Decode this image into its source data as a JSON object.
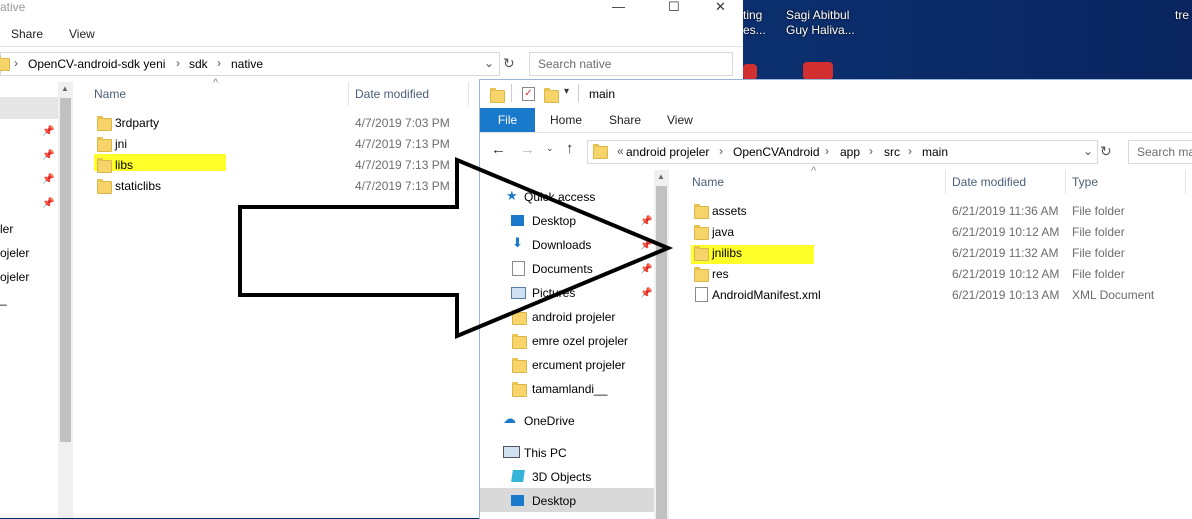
{
  "desktop": {
    "icon1_label_line1": "ting",
    "icon1_label_line2": "es...",
    "icon2_label_line1": "Sagi Abitbul",
    "icon2_label_line2": "Guy Haliva...",
    "icon3_label": "tre"
  },
  "win1": {
    "title": "ative",
    "menu": [
      "Share",
      "View"
    ],
    "breadcrumb": [
      "OpenCV-android-sdk yeni",
      "sdk",
      "native"
    ],
    "search_placeholder": "Search native",
    "nav_items": [
      "ler",
      "ojeler",
      "ojeler",
      "_"
    ],
    "columns": {
      "name": "Name",
      "date": "Date modified"
    },
    "rows": [
      {
        "name": "3rdparty",
        "date": "4/7/2019 7:03 PM"
      },
      {
        "name": "jni",
        "date": "4/7/2019 7:13 PM"
      },
      {
        "name": "libs",
        "date": "4/7/2019 7:13 PM"
      },
      {
        "name": "staticlibs",
        "date": "4/7/2019 7:13 PM"
      }
    ]
  },
  "win2": {
    "title": "main",
    "ribbon": {
      "file": "File",
      "home": "Home",
      "share": "Share",
      "view": "View"
    },
    "breadcrumb": [
      "«",
      "android projeler",
      "OpenCVAndroid",
      "app",
      "src",
      "main"
    ],
    "search_placeholder": "Search ma",
    "nav": {
      "quick_access": "Quick access",
      "desktop": "Desktop",
      "downloads": "Downloads",
      "documents": "Documents",
      "pictures": "Pictures",
      "android": "android projeler",
      "emre": "emre ozel projeler",
      "ercument": "ercument projeler",
      "tamam": "tamamlandi__",
      "onedrive": "OneDrive",
      "thispc": "This PC",
      "objects3d": "3D Objects",
      "desktop2": "Desktop"
    },
    "columns": {
      "name": "Name",
      "date": "Date modified",
      "type": "Type"
    },
    "rows": [
      {
        "name": "assets",
        "date": "6/21/2019 11:36 AM",
        "type": "File folder"
      },
      {
        "name": "java",
        "date": "6/21/2019 10:12 AM",
        "type": "File folder"
      },
      {
        "name": "jnilibs",
        "date": "6/21/2019 11:32 AM",
        "type": "File folder"
      },
      {
        "name": "res",
        "date": "6/21/2019 10:12 AM",
        "type": "File folder"
      },
      {
        "name": "AndroidManifest.xml",
        "date": "6/21/2019 10:13 AM",
        "type": "XML Document"
      }
    ]
  },
  "colors": {
    "highlight": "#ffff2a",
    "accent": "#1979ca"
  }
}
